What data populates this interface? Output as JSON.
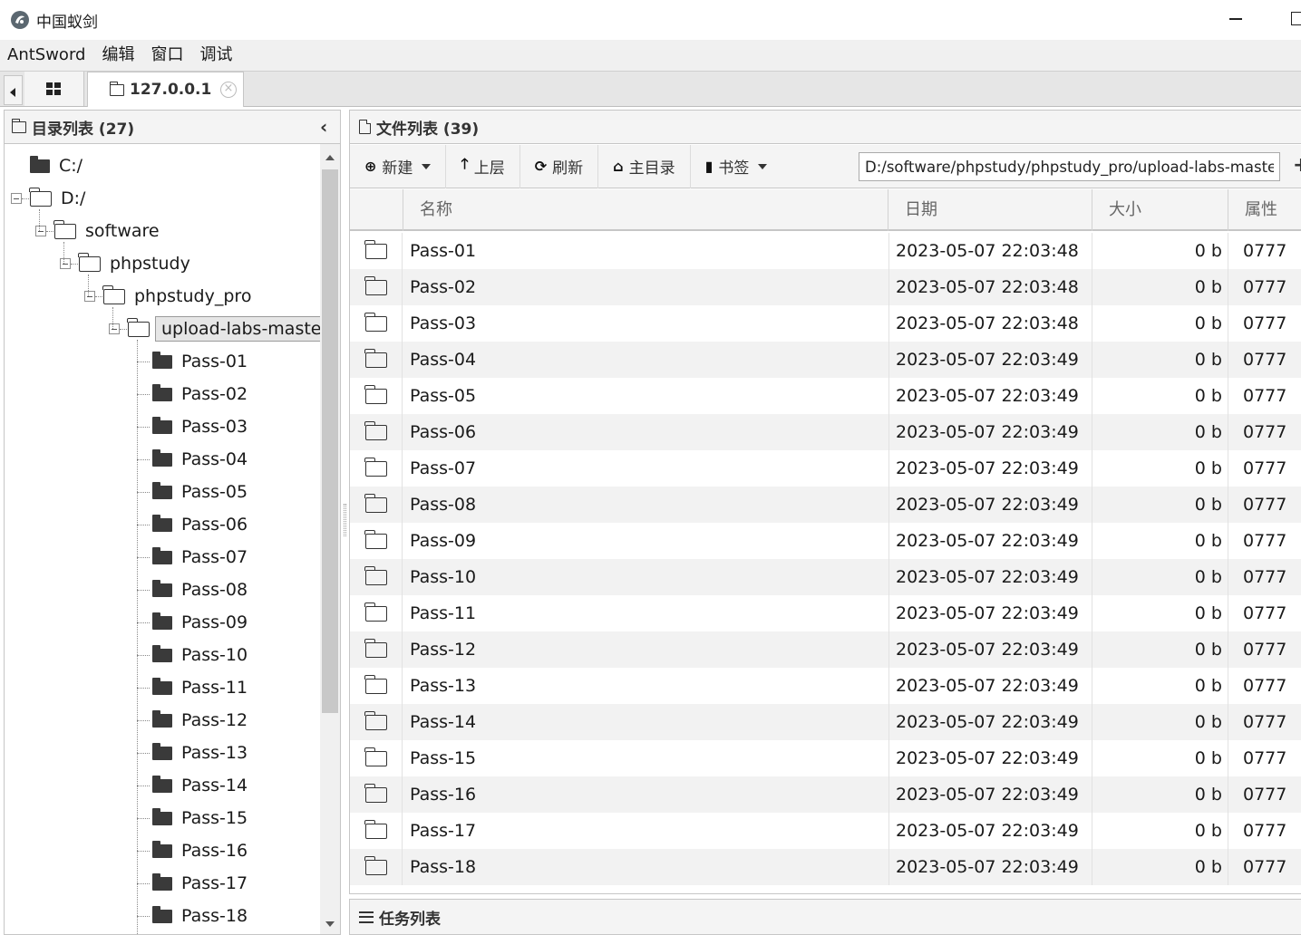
{
  "window": {
    "title": "中国蚁剑"
  },
  "menu": [
    "AntSword",
    "编辑",
    "窗口",
    "调试"
  ],
  "tabs": {
    "host": "127.0.0.1"
  },
  "dir_panel": {
    "title": "目录列表 (27)",
    "tree": [
      {
        "label": "C:/",
        "depth": 0,
        "icon": "folder-solid",
        "expanded": false
      },
      {
        "label": "D:/",
        "depth": 0,
        "icon": "folder-open",
        "expanded": true
      },
      {
        "label": "software",
        "depth": 1,
        "icon": "folder-open",
        "expanded": true
      },
      {
        "label": "phpstudy",
        "depth": 2,
        "icon": "folder-open",
        "expanded": true
      },
      {
        "label": "phpstudy_pro",
        "depth": 3,
        "icon": "folder-open",
        "expanded": true
      },
      {
        "label": "upload-labs-master",
        "depth": 4,
        "icon": "folder-open",
        "expanded": true,
        "selected": true
      },
      {
        "label": "Pass-01",
        "depth": 5,
        "icon": "folder-solid"
      },
      {
        "label": "Pass-02",
        "depth": 5,
        "icon": "folder-solid"
      },
      {
        "label": "Pass-03",
        "depth": 5,
        "icon": "folder-solid"
      },
      {
        "label": "Pass-04",
        "depth": 5,
        "icon": "folder-solid"
      },
      {
        "label": "Pass-05",
        "depth": 5,
        "icon": "folder-solid"
      },
      {
        "label": "Pass-06",
        "depth": 5,
        "icon": "folder-solid"
      },
      {
        "label": "Pass-07",
        "depth": 5,
        "icon": "folder-solid"
      },
      {
        "label": "Pass-08",
        "depth": 5,
        "icon": "folder-solid"
      },
      {
        "label": "Pass-09",
        "depth": 5,
        "icon": "folder-solid"
      },
      {
        "label": "Pass-10",
        "depth": 5,
        "icon": "folder-solid"
      },
      {
        "label": "Pass-11",
        "depth": 5,
        "icon": "folder-solid"
      },
      {
        "label": "Pass-12",
        "depth": 5,
        "icon": "folder-solid"
      },
      {
        "label": "Pass-13",
        "depth": 5,
        "icon": "folder-solid"
      },
      {
        "label": "Pass-14",
        "depth": 5,
        "icon": "folder-solid"
      },
      {
        "label": "Pass-15",
        "depth": 5,
        "icon": "folder-solid"
      },
      {
        "label": "Pass-16",
        "depth": 5,
        "icon": "folder-solid"
      },
      {
        "label": "Pass-17",
        "depth": 5,
        "icon": "folder-solid"
      },
      {
        "label": "Pass-18",
        "depth": 5,
        "icon": "folder-solid"
      }
    ]
  },
  "file_panel": {
    "title": "文件列表 (39)",
    "toolbar": {
      "new_label": "新建",
      "up_label": "上层",
      "refresh_label": "刷新",
      "home_label": "主目录",
      "bookmark_label": "书签",
      "path_value": "D:/software/phpstudy/phpstudy_pro/upload-labs-master/"
    },
    "columns": {
      "name": "名称",
      "date": "日期",
      "size": "大小",
      "attr": "属性"
    },
    "rows": [
      {
        "name": "Pass-01",
        "date": "2023-05-07 22:03:48",
        "size": "0 b",
        "attr": "0777"
      },
      {
        "name": "Pass-02",
        "date": "2023-05-07 22:03:48",
        "size": "0 b",
        "attr": "0777"
      },
      {
        "name": "Pass-03",
        "date": "2023-05-07 22:03:48",
        "size": "0 b",
        "attr": "0777"
      },
      {
        "name": "Pass-04",
        "date": "2023-05-07 22:03:49",
        "size": "0 b",
        "attr": "0777"
      },
      {
        "name": "Pass-05",
        "date": "2023-05-07 22:03:49",
        "size": "0 b",
        "attr": "0777"
      },
      {
        "name": "Pass-06",
        "date": "2023-05-07 22:03:49",
        "size": "0 b",
        "attr": "0777"
      },
      {
        "name": "Pass-07",
        "date": "2023-05-07 22:03:49",
        "size": "0 b",
        "attr": "0777"
      },
      {
        "name": "Pass-08",
        "date": "2023-05-07 22:03:49",
        "size": "0 b",
        "attr": "0777"
      },
      {
        "name": "Pass-09",
        "date": "2023-05-07 22:03:49",
        "size": "0 b",
        "attr": "0777"
      },
      {
        "name": "Pass-10",
        "date": "2023-05-07 22:03:49",
        "size": "0 b",
        "attr": "0777"
      },
      {
        "name": "Pass-11",
        "date": "2023-05-07 22:03:49",
        "size": "0 b",
        "attr": "0777"
      },
      {
        "name": "Pass-12",
        "date": "2023-05-07 22:03:49",
        "size": "0 b",
        "attr": "0777"
      },
      {
        "name": "Pass-13",
        "date": "2023-05-07 22:03:49",
        "size": "0 b",
        "attr": "0777"
      },
      {
        "name": "Pass-14",
        "date": "2023-05-07 22:03:49",
        "size": "0 b",
        "attr": "0777"
      },
      {
        "name": "Pass-15",
        "date": "2023-05-07 22:03:49",
        "size": "0 b",
        "attr": "0777"
      },
      {
        "name": "Pass-16",
        "date": "2023-05-07 22:03:49",
        "size": "0 b",
        "attr": "0777"
      },
      {
        "name": "Pass-17",
        "date": "2023-05-07 22:03:49",
        "size": "0 b",
        "attr": "0777"
      },
      {
        "name": "Pass-18",
        "date": "2023-05-07 22:03:49",
        "size": "0 b",
        "attr": "0777"
      }
    ]
  },
  "task_panel": {
    "title": "任务列表"
  }
}
